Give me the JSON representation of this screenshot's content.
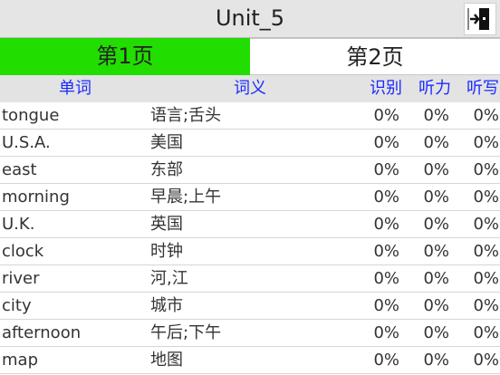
{
  "window": {
    "title": "Unit_5",
    "exit_icon": "exit-door-icon"
  },
  "tabs": [
    {
      "label": "第1页",
      "active": true,
      "color": "#22dd00"
    },
    {
      "label": "第2页",
      "active": false,
      "color": "#ffffff"
    }
  ],
  "table": {
    "headers": {
      "word": "单词",
      "meaning": "词义",
      "recognize": "识别",
      "listen": "听力",
      "dictation": "听写"
    },
    "rows": [
      {
        "word": "tongue",
        "meaning": "语言;舌头",
        "recognize": "0%",
        "listen": "0%",
        "dictation": "0%"
      },
      {
        "word": "U.S.A.",
        "meaning": "美国",
        "recognize": "0%",
        "listen": "0%",
        "dictation": "0%"
      },
      {
        "word": "east",
        "meaning": "东部",
        "recognize": "0%",
        "listen": "0%",
        "dictation": "0%"
      },
      {
        "word": "morning",
        "meaning": "早晨;上午",
        "recognize": "0%",
        "listen": "0%",
        "dictation": "0%"
      },
      {
        "word": "U.K.",
        "meaning": "英国",
        "recognize": "0%",
        "listen": "0%",
        "dictation": "0%"
      },
      {
        "word": "clock",
        "meaning": "时钟",
        "recognize": "0%",
        "listen": "0%",
        "dictation": "0%"
      },
      {
        "word": "river",
        "meaning": "河,江",
        "recognize": "0%",
        "listen": "0%",
        "dictation": "0%"
      },
      {
        "word": "city",
        "meaning": "城市",
        "recognize": "0%",
        "listen": "0%",
        "dictation": "0%"
      },
      {
        "word": "afternoon",
        "meaning": "午后;下午",
        "recognize": "0%",
        "listen": "0%",
        "dictation": "0%"
      },
      {
        "word": "map",
        "meaning": "地图",
        "recognize": "0%",
        "listen": "0%",
        "dictation": "0%"
      }
    ]
  },
  "colors": {
    "header_text": "#1a2bff",
    "active_tab": "#22dd00",
    "title_bar": "#e5e5e5"
  }
}
